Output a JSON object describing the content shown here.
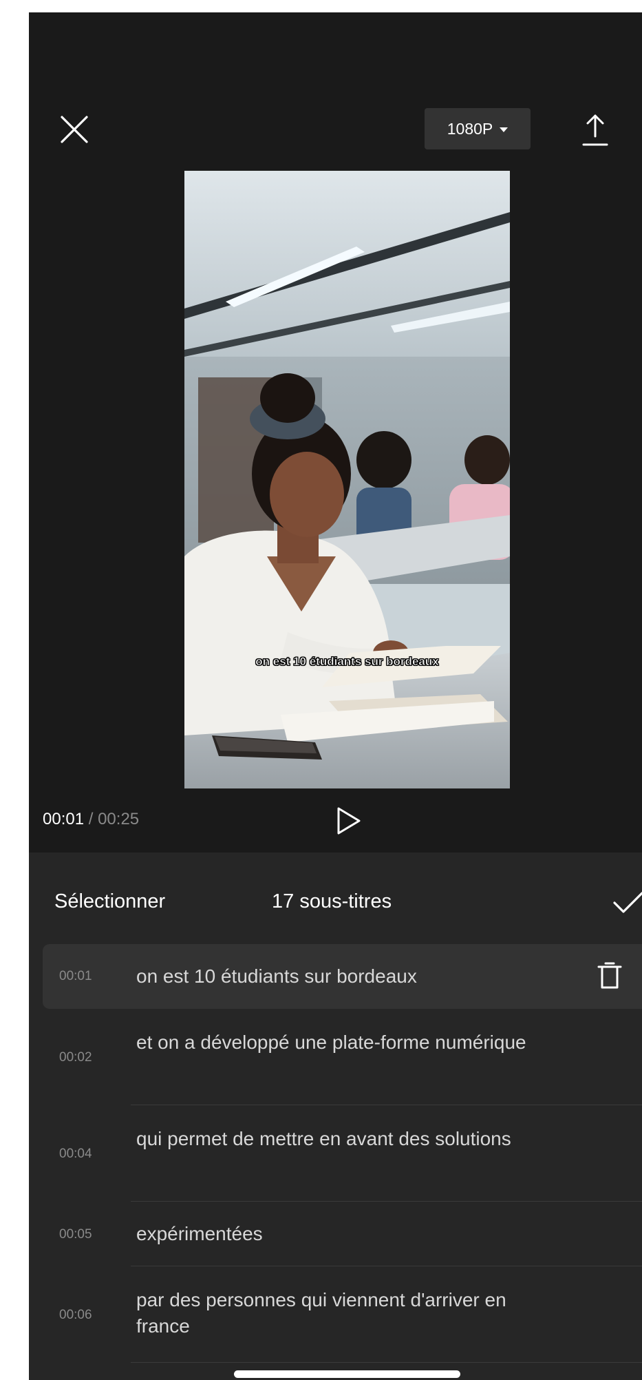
{
  "header": {
    "resolution_label": "1080P"
  },
  "video": {
    "caption": "on est 10 étudiants sur bordeaux"
  },
  "playback": {
    "current_time": "00:01",
    "separator": " / ",
    "total_time": "00:25"
  },
  "subtitles_panel": {
    "select_label": "Sélectionner",
    "count_label": "17 sous-titres",
    "items": [
      {
        "time": "00:01",
        "text": "on est 10 étudiants sur bordeaux",
        "selected": true
      },
      {
        "time": "00:02",
        "text": "et on a développé une plate-forme numérique"
      },
      {
        "time": "00:04",
        "text": "qui permet de mettre en avant des solutions"
      },
      {
        "time": "00:05",
        "text": "expérimentées"
      },
      {
        "time": "00:06",
        "text": "par des personnes qui viennent d'arriver en france"
      }
    ]
  },
  "colors": {
    "background": "#1a1a1a",
    "panel": "#262626",
    "selected_row": "#333333",
    "muted_text": "#8a8a8a",
    "primary_text": "#ffffff"
  },
  "icons": {
    "close": "close-icon",
    "export": "upload-icon",
    "play": "play-icon",
    "confirm": "checkmark-icon",
    "delete": "trash-icon"
  }
}
